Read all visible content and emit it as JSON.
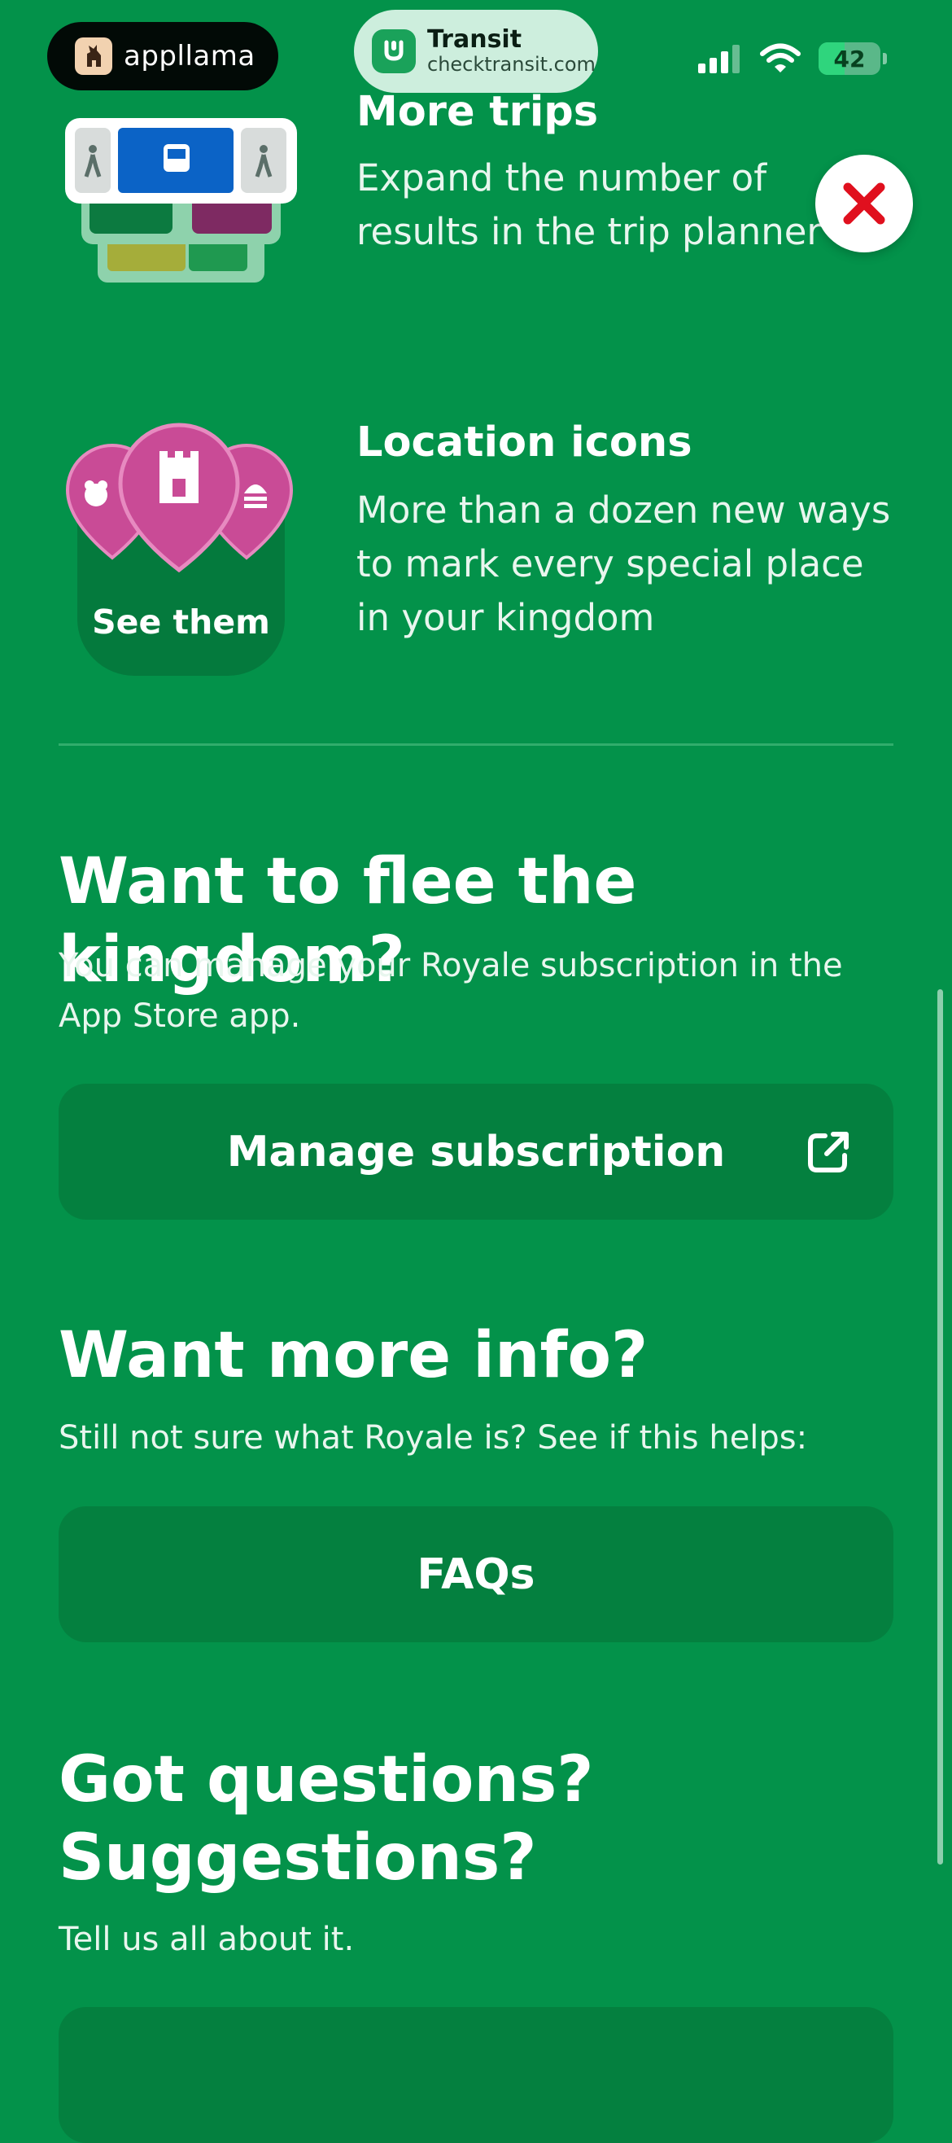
{
  "status_bar": {
    "app_pill": "appllama",
    "transit_name": "Transit",
    "transit_url": "checktransit.com",
    "battery_level": "42"
  },
  "features": [
    {
      "title": "More trips",
      "description": "Expand the number of results in the trip planner"
    },
    {
      "title": "Location icons",
      "description": "More than a dozen new ways to mark every special place in your kingdom",
      "illustration_label": "See them"
    }
  ],
  "sections": {
    "flee": {
      "title": "Want to flee the kingdom?",
      "description": "You can manage your Royale subscription in the App Store app.",
      "button": "Manage subscription"
    },
    "info": {
      "title": "Want more info?",
      "description": "Still not sure what Royale is? See if this helps:",
      "button": "FAQs"
    },
    "questions": {
      "title_line1": "Got questions?",
      "title_line2": "Suggestions?",
      "description": "Tell us all about it."
    }
  },
  "colors": {
    "background": "#03924a",
    "button": "#04803f",
    "close_x": "#e0101e"
  }
}
